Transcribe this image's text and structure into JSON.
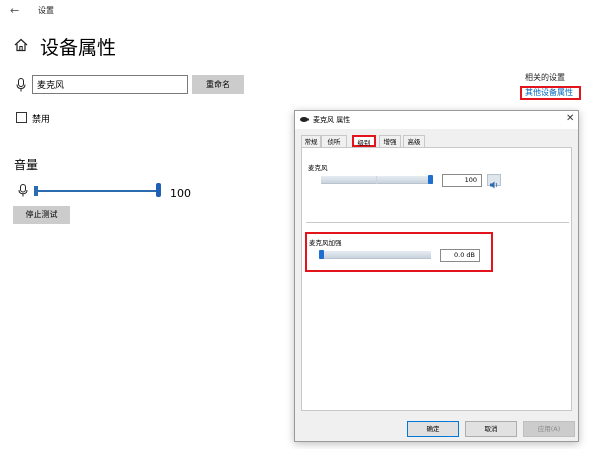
{
  "window": {
    "title": "设置",
    "back_glyph": "←"
  },
  "page": {
    "title": "设备属性"
  },
  "device": {
    "name_value": "麦克风",
    "rename_label": "重命名"
  },
  "disable": {
    "label": "禁用"
  },
  "volume": {
    "title": "音量",
    "value": "100",
    "level_percent": 100,
    "stop_test_label": "停止测试"
  },
  "related": {
    "title": "相关的设置",
    "other_props_link": "其他设备属性"
  },
  "dialog": {
    "title": "麦克风 属性",
    "close_glyph": "✕",
    "tabs": [
      "常规",
      "侦听",
      "级别",
      "增强",
      "高级"
    ],
    "active_tab": "级别",
    "mic_group": {
      "label": "麦克风",
      "value": "100",
      "level_percent": 100
    },
    "boost_group": {
      "label": "麦克风加强",
      "value": "0.0 dB",
      "level_percent": 0
    },
    "buttons": {
      "ok": "确定",
      "cancel": "取消",
      "apply": "应用(A)"
    }
  },
  "colors": {
    "accent": "#1f6fd1",
    "highlight": "#e3141b",
    "link": "#0067c0"
  },
  "icons": [
    "back-arrow-icon",
    "home-icon",
    "microphone-icon",
    "speaker-icon"
  ]
}
